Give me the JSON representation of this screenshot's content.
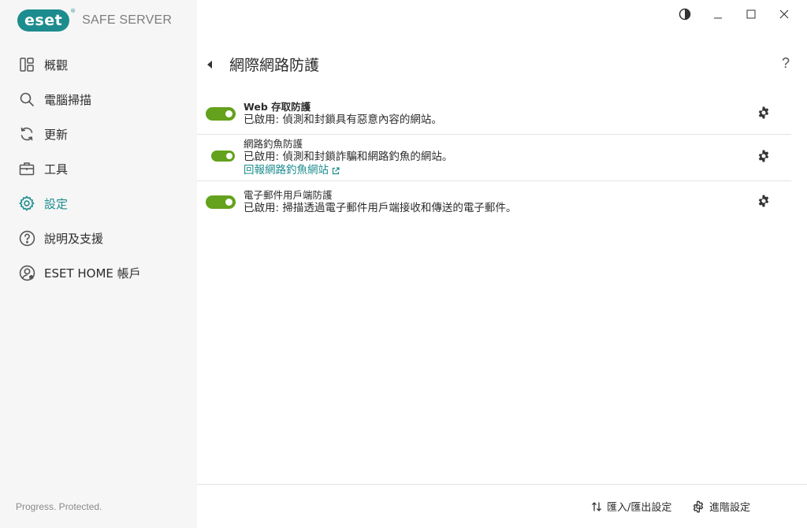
{
  "app": {
    "logo_text": "eset",
    "product_name": "SAFE SERVER"
  },
  "window_controls": [
    {
      "name": "theme-toggle-button",
      "icon": "contrast-icon"
    },
    {
      "name": "minimize-button",
      "icon": "minimize-icon"
    },
    {
      "name": "maximize-button",
      "icon": "maximize-icon"
    },
    {
      "name": "close-button",
      "icon": "close-icon"
    }
  ],
  "sidebar": {
    "items": [
      {
        "label": "概觀",
        "icon": "overview-icon"
      },
      {
        "label": "電腦掃描",
        "icon": "scan-icon"
      },
      {
        "label": "更新",
        "icon": "update-icon"
      },
      {
        "label": "工具",
        "icon": "tools-icon"
      },
      {
        "label": "設定",
        "icon": "settings-icon",
        "active": true
      },
      {
        "label": "說明及支援",
        "icon": "help-icon"
      },
      {
        "label": "ESET HOME 帳戶",
        "icon": "account-icon"
      }
    ],
    "footer": "Progress. Protected."
  },
  "page": {
    "title": "網際網路防護",
    "help": "?"
  },
  "features": [
    {
      "title": "Web 存取防護",
      "status": "已啟用: 偵測和封鎖具有惡意內容的網站。",
      "enabled": true
    },
    {
      "title": "網路釣魚防護",
      "status": "已啟用: 偵測和封鎖詐騙和網路釣魚的網站。",
      "link": "回報網路釣魚網站",
      "enabled": true
    },
    {
      "title": "電子郵件用戶端防護",
      "status": "已啟用: 掃描透過電子郵件用戶端接收和傳送的電子郵件。",
      "enabled": true
    }
  ],
  "footer": {
    "import_export": "匯入/匯出設定",
    "advanced": "進階設定"
  },
  "colors": {
    "accent": "#1d8c8e",
    "toggle_on": "#64a11c",
    "sidebar_bg": "#f6f6f6",
    "divider": "#e3e3e3"
  }
}
